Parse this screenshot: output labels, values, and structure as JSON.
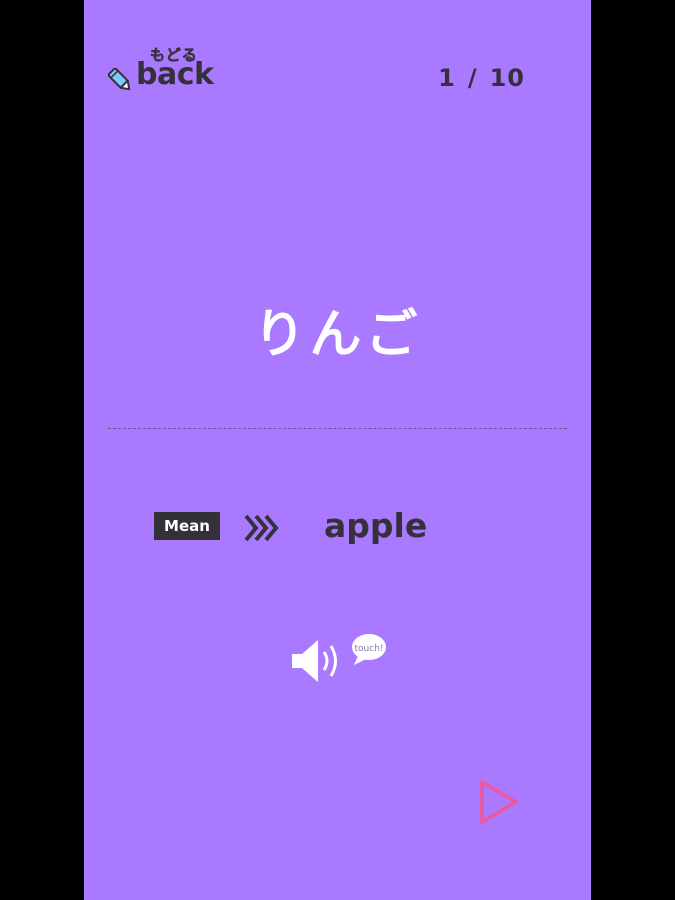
{
  "header": {
    "back_kana": "もどる",
    "back_label": "back",
    "counter_current": "1",
    "counter_sep": "/",
    "counter_total": "10"
  },
  "card": {
    "word": "りんご",
    "mean_badge": "Mean",
    "meaning": "apple"
  },
  "sound": {
    "bubble_text": "touch!"
  },
  "colors": {
    "panel": "#a97aff",
    "dark": "#35303b",
    "next_arrow": "#e85aa8"
  },
  "icons": [
    "pencil-icon",
    "chevron-double-right-icon",
    "speaker-icon",
    "speech-bubble-icon",
    "play-arrow-icon"
  ]
}
